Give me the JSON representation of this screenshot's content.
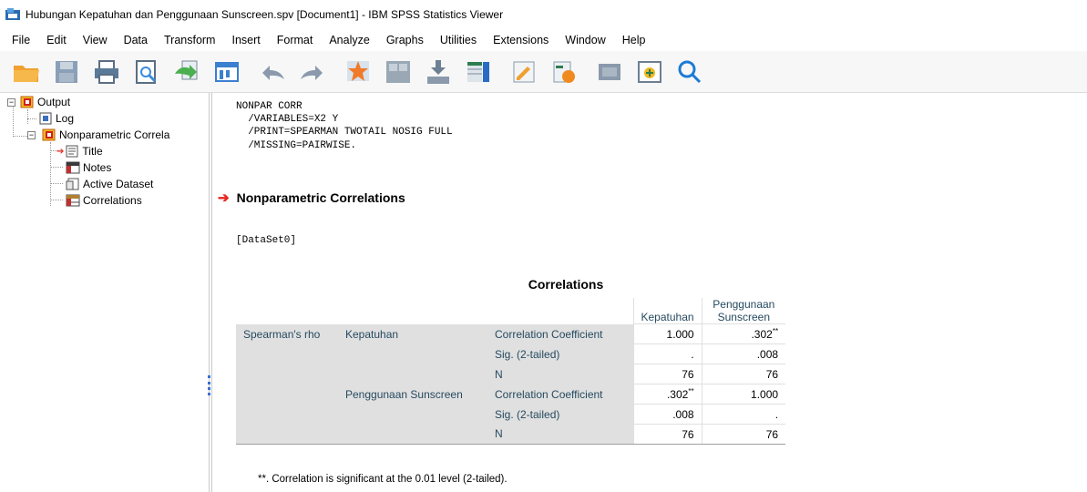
{
  "window": {
    "title": "Hubungan Kepatuhan dan Penggunaan Sunscreen.spv [Document1] - IBM SPSS Statistics Viewer"
  },
  "menu": [
    "File",
    "Edit",
    "View",
    "Data",
    "Transform",
    "Insert",
    "Format",
    "Analyze",
    "Graphs",
    "Utilities",
    "Extensions",
    "Window",
    "Help"
  ],
  "toolbar": {
    "icons": [
      "open-icon",
      "save-icon",
      "print-icon",
      "print-preview-icon",
      "export-icon",
      "recall-dialog-icon",
      "undo-icon",
      "redo-icon",
      "goto-case-icon",
      "goto-variable-icon",
      "insert-cases-icon",
      "insert-variable-icon",
      "designate-window-icon",
      "run-script-icon",
      "show-hide-icon",
      "insert-output-icon",
      "search-icon"
    ]
  },
  "outline": {
    "root": "Output",
    "log": "Log",
    "group": "Nonparametric Correla",
    "children": [
      "Title",
      "Notes",
      "Active Dataset",
      "Correlations"
    ]
  },
  "content": {
    "syntax": "NONPAR CORR\n  /VARIABLES=X2 Y\n  /PRINT=SPEARMAN TWOTAIL NOSIG FULL\n  /MISSING=PAIRWISE.",
    "section_title": "Nonparametric Correlations",
    "dataset": "[DataSet0]",
    "table": {
      "title": "Correlations",
      "col1": "Kepatuhan",
      "col2_line1": "Penggunaan",
      "col2_line2": "Sunscreen",
      "method": "Spearman's rho",
      "var1": "Kepatuhan",
      "var2": "Penggunaan Sunscreen",
      "stat_cc": "Correlation Coefficient",
      "stat_sig": "Sig. (2-tailed)",
      "stat_n": "N",
      "r1_cc_a": "1.000",
      "r1_cc_b": ".302",
      "r1_sig_a": ".",
      "r1_sig_b": ".008",
      "r1_n_a": "76",
      "r1_n_b": "76",
      "r2_cc_a": ".302",
      "r2_cc_b": "1.000",
      "r2_sig_a": ".008",
      "r2_sig_b": ".",
      "r2_n_a": "76",
      "r2_n_b": "76",
      "sig_mark": "**"
    },
    "footnote": "**. Correlation is significant at the 0.01 level (2-tailed)."
  },
  "colors": {
    "accent_red": "#e8261f",
    "table_label_bg": "#e0e0e0",
    "table_text": "#264a60"
  }
}
